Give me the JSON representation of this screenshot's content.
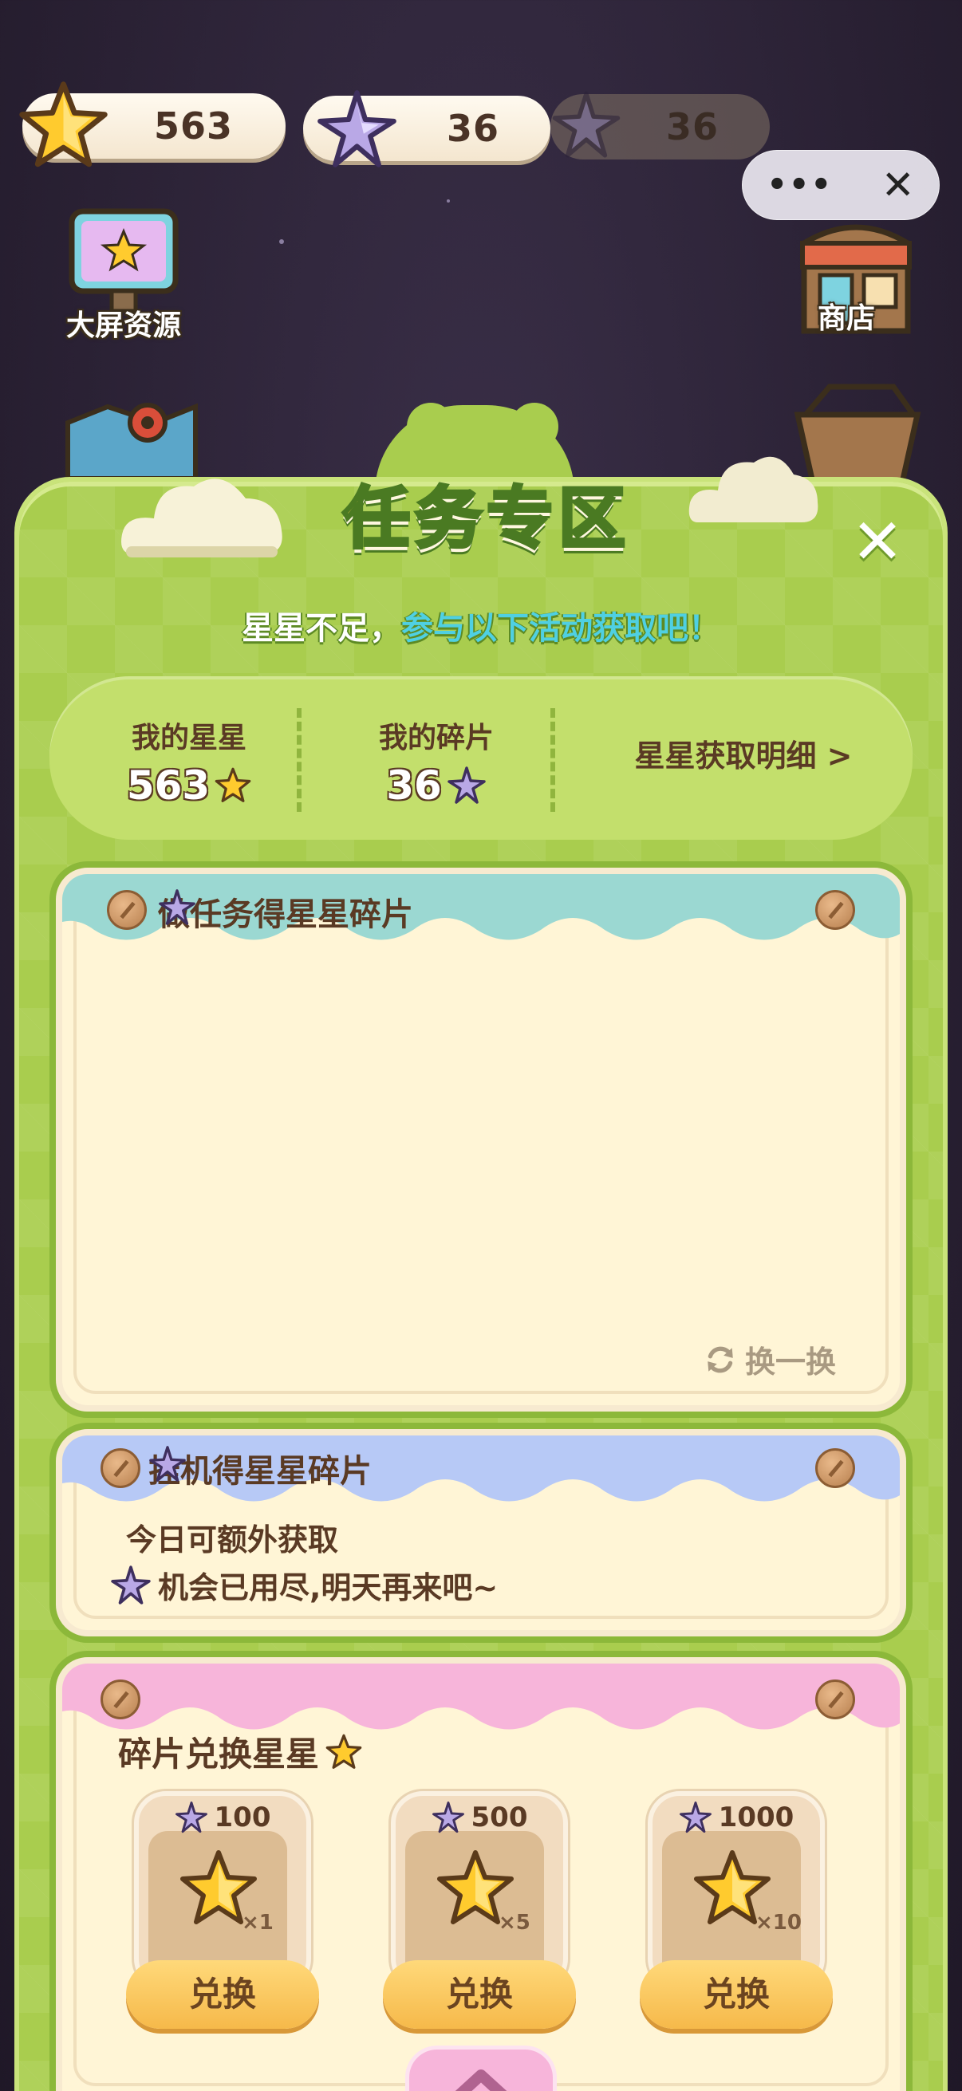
{
  "hud": {
    "stars": "563",
    "fragments": "36",
    "fragments_dim": "36"
  },
  "capsule": {
    "more": "•••",
    "close": "✕"
  },
  "side": {
    "big_screen": "大屏资源",
    "shop": "商店"
  },
  "panel": {
    "title": "任务专区",
    "close": "✕",
    "subtitle_prefix": "星星不足，",
    "subtitle_highlight": "参与以下活动获取吧！"
  },
  "stats": {
    "my_stars_label": "我的星星",
    "my_stars_value": "563",
    "my_fragments_label": "我的碎片",
    "my_fragments_value": "36",
    "detail_link": "星星获取明细 >"
  },
  "tasks_card": {
    "title": "做任务得星星碎片",
    "refresh": "换一换"
  },
  "afk_card": {
    "title": "挂机得星星碎片",
    "line1": "今日可额外获取",
    "line2": "机会已用尽,明天再来吧~"
  },
  "exchange_card": {
    "title": "碎片兑换星星",
    "items": [
      {
        "cost": "100",
        "mult": "×1",
        "button": "兑换"
      },
      {
        "cost": "500",
        "mult": "×5",
        "button": "兑换"
      },
      {
        "cost": "1000",
        "mult": "×10",
        "button": "兑换"
      }
    ]
  },
  "colors": {
    "panel_green": "#a9cd4e",
    "cream": "#fff5d6",
    "teal_wave": "#9bd8d2",
    "blue_wave": "#b7c9f6",
    "pink_wave": "#f7b5da",
    "gold": "#ffc94a"
  },
  "icons": [
    "star-icon",
    "fragment-icon",
    "close-icon",
    "more-icon",
    "refresh-icon",
    "pin-icon",
    "chevron-up-icon",
    "billboard-icon",
    "shop-icon",
    "map-icon",
    "basket-icon"
  ]
}
